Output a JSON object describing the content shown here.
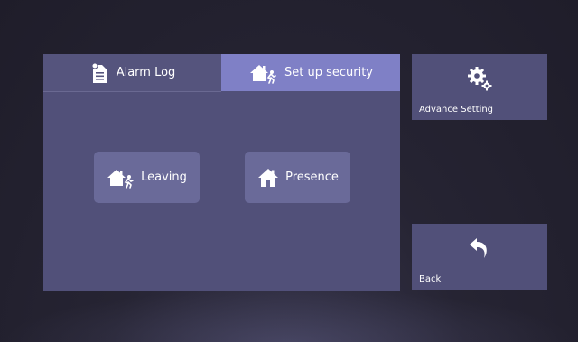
{
  "tabs": {
    "alarm_log": {
      "label": "Alarm Log",
      "icon": "document-icon",
      "active": false
    },
    "setup_security": {
      "label": "Set up security",
      "icon": "house-running-person-icon",
      "active": true
    }
  },
  "modes": {
    "leaving": {
      "label": "Leaving",
      "icon": "house-running-person-icon"
    },
    "presence": {
      "label": "Presence",
      "icon": "house-icon"
    }
  },
  "side": {
    "advance_setting": {
      "label": "Advance Setting",
      "icon": "gears-icon"
    },
    "back": {
      "label": "Back",
      "icon": "back-arrow-icon"
    }
  },
  "colors": {
    "panel": "#515079",
    "active_tab": "#7f80c6",
    "mode_button": "#6a6a99",
    "background": "#262433"
  }
}
